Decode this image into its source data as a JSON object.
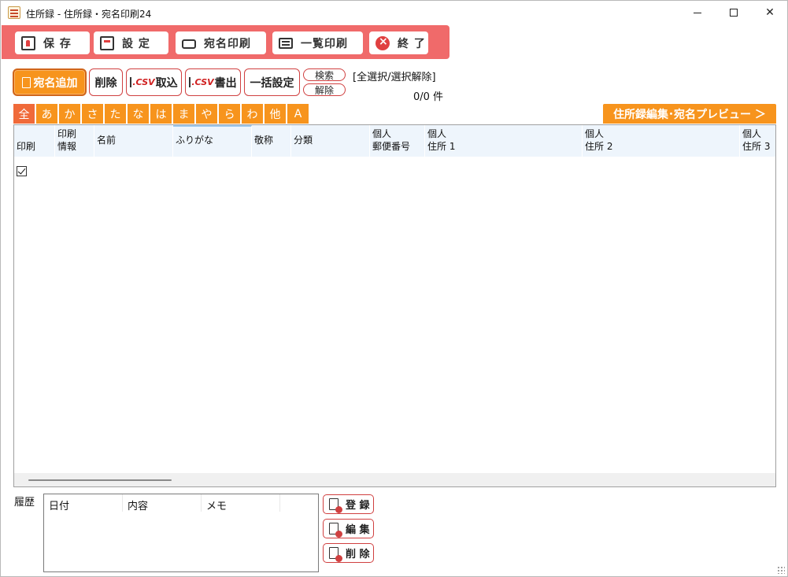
{
  "window": {
    "title": "住所録 - 住所録・宛名印刷24",
    "controls": {
      "minimize": "minimize",
      "maximize": "maximize",
      "close": "close"
    }
  },
  "toolbar_main": {
    "save": "保 存",
    "settings": "設 定",
    "address_print": "宛名印刷",
    "list_print": "一覧印刷",
    "exit": "終 了"
  },
  "toolbar_sub": {
    "add": "宛名追加",
    "delete": "削除",
    "csv_import_tag": ".CSV",
    "csv_import": "取込",
    "csv_export_tag": ".CSV",
    "csv_export": "書出",
    "bulk_settings": "一括設定",
    "search": "検索",
    "clear": "解除",
    "select_toggle": "[全選択/選択解除]",
    "count": "0/0 件"
  },
  "kana_tabs": [
    "全",
    "あ",
    "か",
    "さ",
    "た",
    "な",
    "は",
    "ま",
    "や",
    "ら",
    "わ",
    "他",
    "A"
  ],
  "preview_tab": "住所録編集･宛名プレビュー ＞",
  "grid": {
    "columns": [
      {
        "label": "印刷"
      },
      {
        "label": "印刷\n情報"
      },
      {
        "label": "名前"
      },
      {
        "label": "ふりがな"
      },
      {
        "label": "敬称"
      },
      {
        "label": "分類"
      },
      {
        "label": "個人\n郵便番号"
      },
      {
        "label": "個人\n住所 1"
      },
      {
        "label": "個人\n住所 2"
      },
      {
        "label": "個人\n住所 3"
      }
    ],
    "rows": []
  },
  "history": {
    "label": "履歴",
    "columns": [
      "日付",
      "内容",
      "メモ"
    ],
    "register": "登 録",
    "edit": "編 集",
    "delete": "削 除"
  }
}
